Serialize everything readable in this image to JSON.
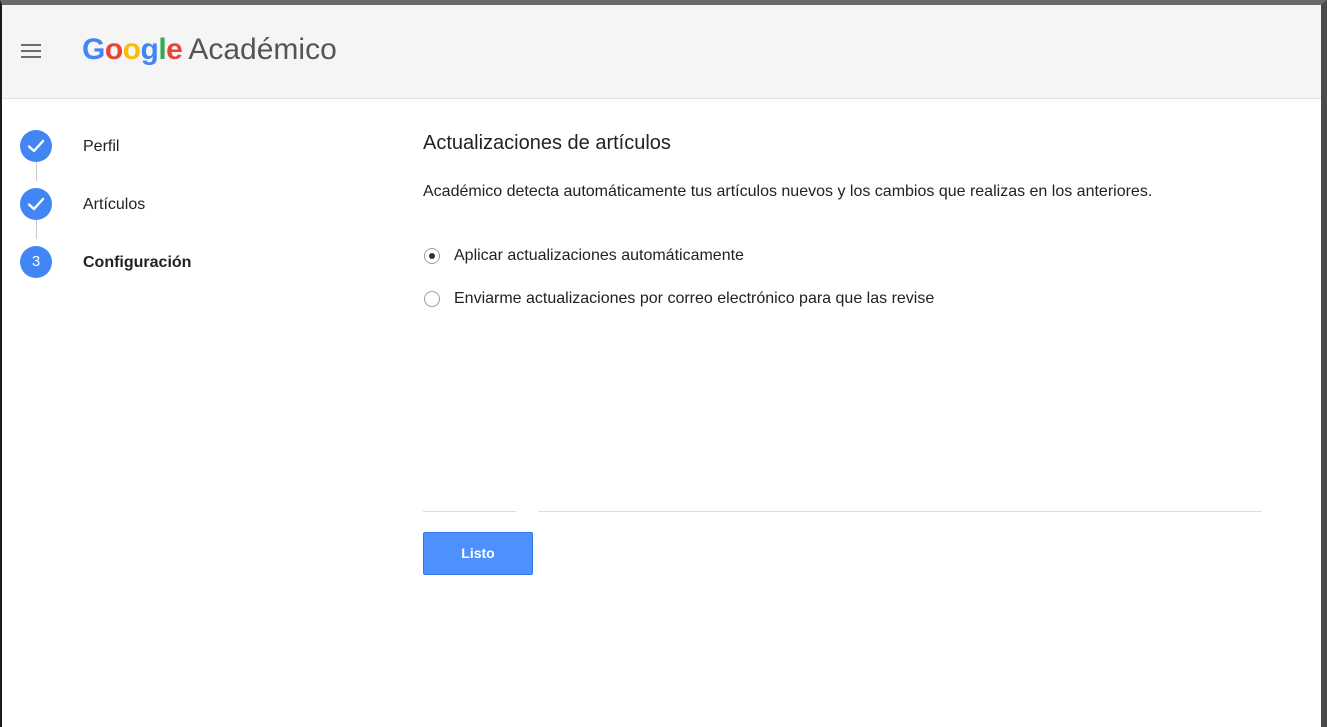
{
  "header": {
    "logo_google": "Google",
    "logo_product": "Académico"
  },
  "stepper": {
    "steps": [
      {
        "label": "Perfil",
        "state": "done",
        "number": "1"
      },
      {
        "label": "Artículos",
        "state": "done",
        "number": "2"
      },
      {
        "label": "Configuración",
        "state": "active",
        "number": "3"
      }
    ]
  },
  "main": {
    "title": "Actualizaciones de artículos",
    "description": "Académico detecta automáticamente tus artículos nuevos y los cambios que realizas en los anteriores.",
    "options": [
      {
        "label": "Aplicar actualizaciones automáticamente",
        "checked": true
      },
      {
        "label": "Enviarme actualizaciones por correo electrónico para que las revise",
        "checked": false
      }
    ],
    "done_label": "Listo"
  },
  "colors": {
    "accent": "#4285f4",
    "button": "#4d90fe",
    "header_bg": "#f5f5f5"
  }
}
